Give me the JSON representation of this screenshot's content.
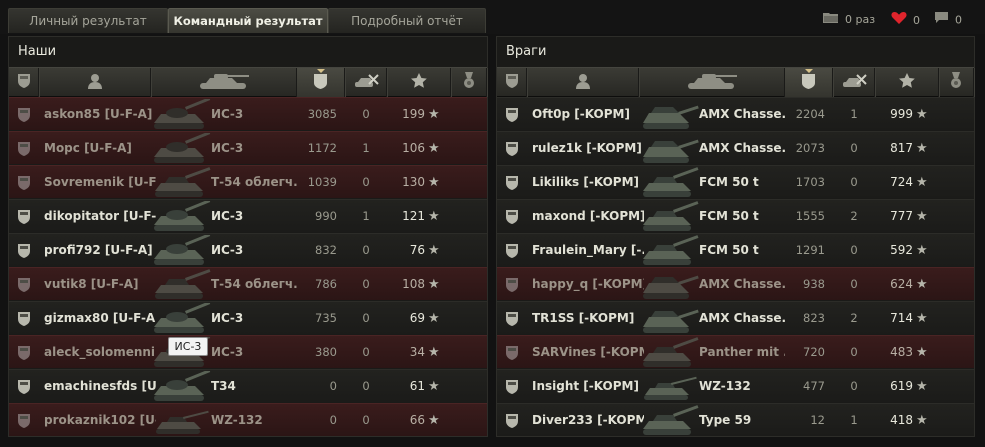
{
  "tabs": [
    {
      "label": "Личный результат",
      "active": false
    },
    {
      "label": "Командный результат",
      "active": true
    },
    {
      "label": "Подробный отчёт",
      "active": false
    }
  ],
  "stats": {
    "folder_label": "0 раз",
    "likes": "0",
    "comments": "0"
  },
  "colors": {
    "accent": "#d6c28a",
    "dead_row": "#3a1c1c",
    "heart": "#e0242c"
  },
  "allies": {
    "title": "Наши",
    "rows": [
      {
        "player": "askon85 [U-F-A]",
        "vehicle": "ИС-3",
        "tank_icon": "heavy-tank-icon",
        "xp": "3085",
        "kills": "0",
        "score": "199",
        "dead": true
      },
      {
        "player": "Морс [U-F-A]",
        "vehicle": "ИС-3",
        "tank_icon": "heavy-tank-icon",
        "xp": "1172",
        "kills": "1",
        "score": "106",
        "dead": true
      },
      {
        "player": "Sovremenik [U-F-...",
        "vehicle": "Т-54 облегч...",
        "tank_icon": "medium-tank-icon",
        "xp": "1039",
        "kills": "0",
        "score": "130",
        "dead": true
      },
      {
        "player": "dikopitator [U-F-A]",
        "vehicle": "ИС-3",
        "tank_icon": "heavy-tank-icon",
        "xp": "990",
        "kills": "1",
        "score": "121",
        "dead": false
      },
      {
        "player": "profi792 [U-F-A]",
        "vehicle": "ИС-3",
        "tank_icon": "heavy-tank-icon",
        "xp": "832",
        "kills": "0",
        "score": "76",
        "dead": false
      },
      {
        "player": "vutik8 [U-F-A]",
        "vehicle": "Т-54 облегч...",
        "tank_icon": "medium-tank-icon",
        "xp": "786",
        "kills": "0",
        "score": "108",
        "dead": true
      },
      {
        "player": "gizmax80 [U-F-A]",
        "vehicle": "ИС-3",
        "tank_icon": "heavy-tank-icon",
        "xp": "735",
        "kills": "0",
        "score": "69",
        "dead": false
      },
      {
        "player": "aleck_solomenni...",
        "vehicle": "ИС-3",
        "tank_icon": "heavy-tank-icon",
        "xp": "380",
        "kills": "0",
        "score": "34",
        "dead": true
      },
      {
        "player": "emachinesfds [U-...",
        "vehicle": "T34",
        "tank_icon": "heavy-tank-icon",
        "xp": "0",
        "kills": "0",
        "score": "61",
        "dead": false
      },
      {
        "player": "prokaznik102 [U-...",
        "vehicle": "WZ-132",
        "tank_icon": "light-tank-icon",
        "xp": "0",
        "kills": "0",
        "score": "66",
        "dead": true
      }
    ]
  },
  "enemies": {
    "title": "Враги",
    "rows": [
      {
        "player": "Oft0p [-KOPM]",
        "vehicle": "AMX Chasse...",
        "tank_icon": "td-icon",
        "xp": "2204",
        "kills": "1",
        "score": "999",
        "dead": false
      },
      {
        "player": "rulez1k [-KOPM]",
        "vehicle": "AMX Chasse...",
        "tank_icon": "td-icon",
        "xp": "2073",
        "kills": "0",
        "score": "817",
        "dead": false
      },
      {
        "player": "Likiliks [-KOPM]",
        "vehicle": "FCM 50 t",
        "tank_icon": "medium-tank-icon",
        "xp": "1703",
        "kills": "0",
        "score": "724",
        "dead": false
      },
      {
        "player": "maxond [-KOPM]",
        "vehicle": "FCM 50 t",
        "tank_icon": "medium-tank-icon",
        "xp": "1555",
        "kills": "2",
        "score": "777",
        "dead": false
      },
      {
        "player": "Fraulein_Mary [-...",
        "vehicle": "FCM 50 t",
        "tank_icon": "medium-tank-icon",
        "xp": "1291",
        "kills": "0",
        "score": "592",
        "dead": false
      },
      {
        "player": "happy_q [-KOPM]",
        "vehicle": "AMX Chasse...",
        "tank_icon": "td-icon",
        "xp": "938",
        "kills": "0",
        "score": "624",
        "dead": true
      },
      {
        "player": "TR1SS [-KOPM]",
        "vehicle": "AMX Chasse...",
        "tank_icon": "td-icon",
        "xp": "823",
        "kills": "2",
        "score": "714",
        "dead": false
      },
      {
        "player": "SARVines [-KOPM]",
        "vehicle": "Panther mit ...",
        "tank_icon": "medium-tank-icon",
        "xp": "720",
        "kills": "0",
        "score": "483",
        "dead": true
      },
      {
        "player": "Insight [-KOPM]",
        "vehicle": "WZ-132",
        "tank_icon": "light-tank-icon",
        "xp": "477",
        "kills": "0",
        "score": "619",
        "dead": false
      },
      {
        "player": "Diver233 [-KOPM]",
        "vehicle": "Type 59",
        "tank_icon": "medium-tank-icon",
        "xp": "12",
        "kills": "1",
        "score": "418",
        "dead": false
      }
    ]
  },
  "tooltip": {
    "text": "ИС-3"
  }
}
